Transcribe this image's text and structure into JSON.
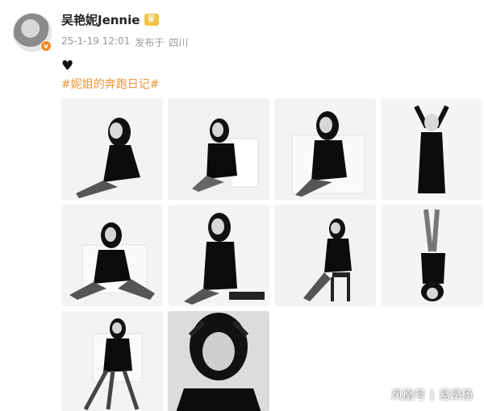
{
  "post": {
    "username": "吴艳妮Jennie",
    "date": "25-1-19 12:01",
    "source_label": "发布于",
    "location": "四川",
    "heart": "♥",
    "hashtag": "#妮姐的奔跑日记#"
  },
  "photos": [
    {
      "alt": "photo-1"
    },
    {
      "alt": "photo-2"
    },
    {
      "alt": "photo-3"
    },
    {
      "alt": "photo-4"
    },
    {
      "alt": "photo-5"
    },
    {
      "alt": "photo-6"
    },
    {
      "alt": "photo-7"
    },
    {
      "alt": "photo-8"
    },
    {
      "alt": "photo-9"
    },
    {
      "alt": "photo-10"
    }
  ],
  "watermark": {
    "site": "风凰号",
    "sep": "|",
    "author": "易昂杨"
  }
}
